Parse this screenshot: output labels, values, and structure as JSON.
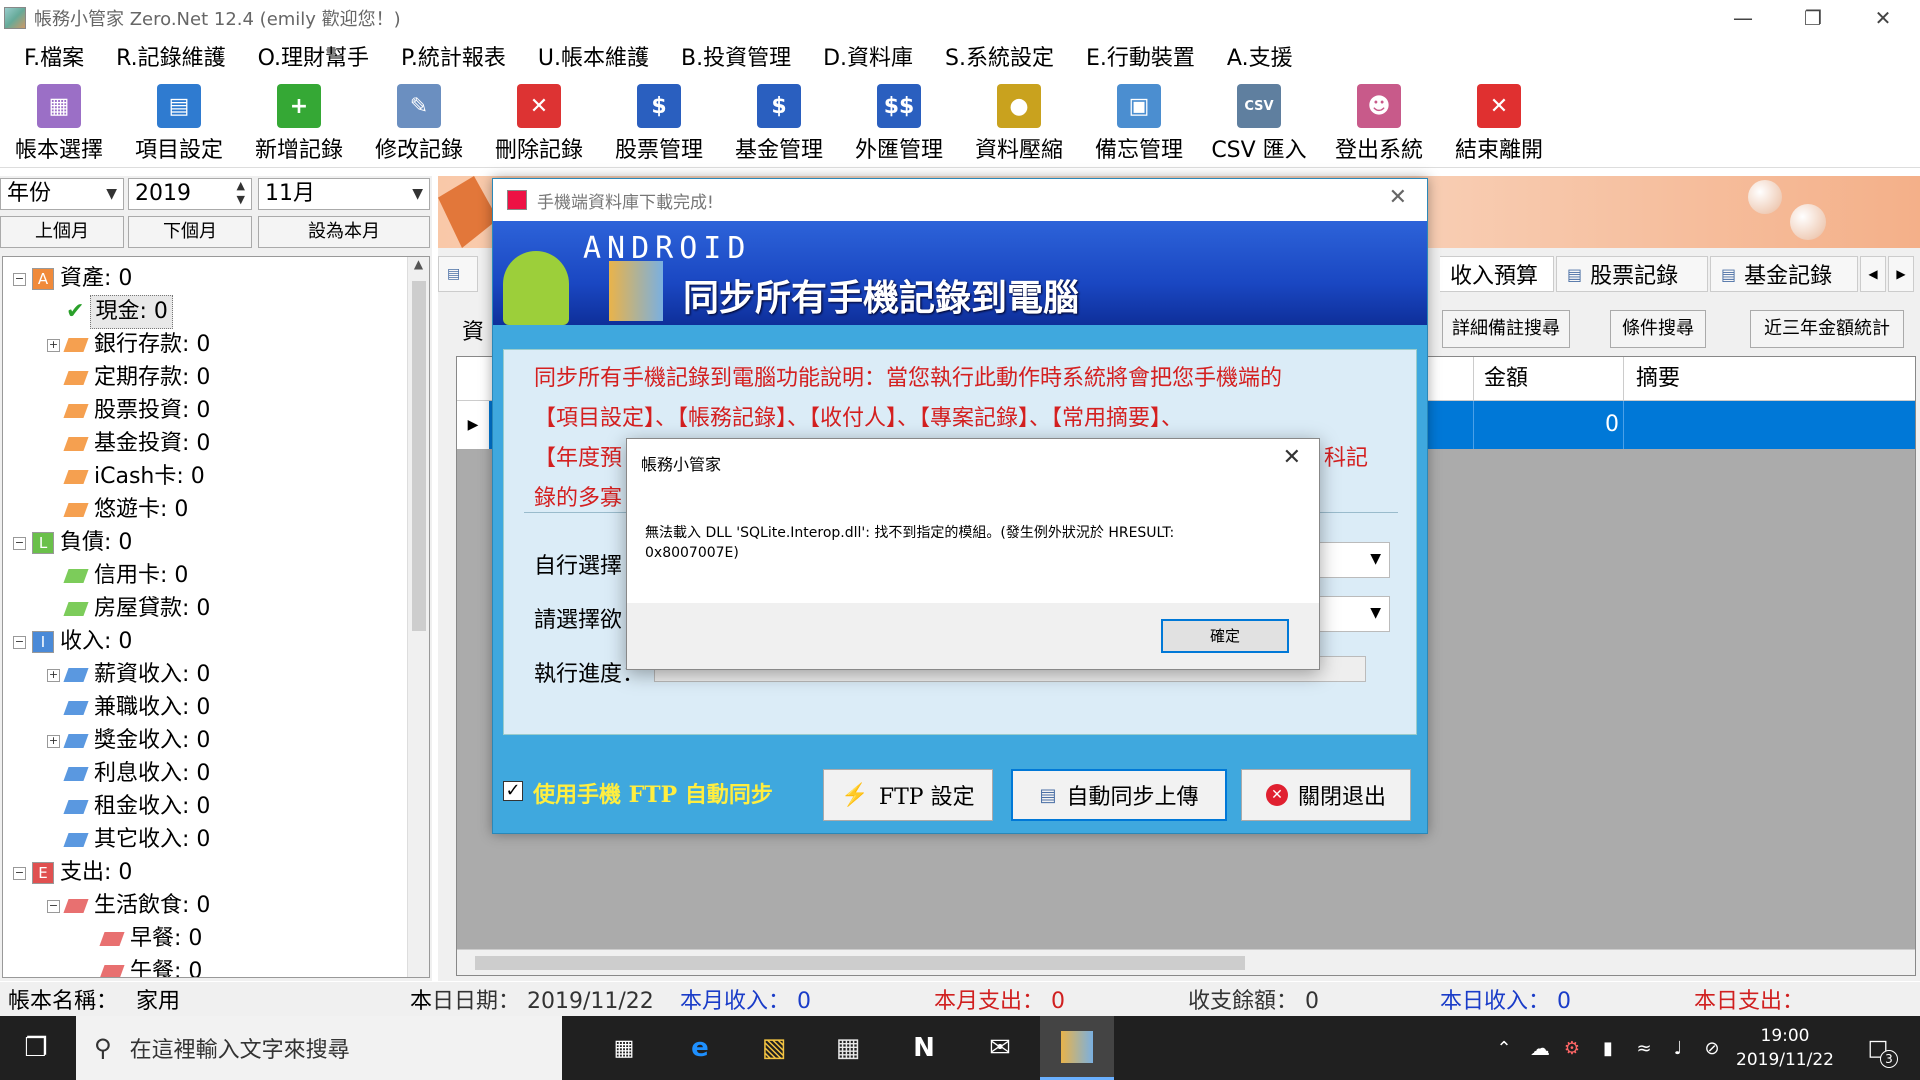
{
  "window": {
    "title": "帳務小管家 Zero.Net 12.4 (emily 歡迎您！)"
  },
  "menu": [
    "F.檔案",
    "R.記錄維護",
    "O.理財幫手",
    "P.統計報表",
    "U.帳本維護",
    "B.投資管理",
    "D.資料庫",
    "S.系統設定",
    "E.行動裝置",
    "A.支援"
  ],
  "toolbar": [
    {
      "label": "帳本選擇",
      "icon": "books-icon",
      "color": "#9b6fc6"
    },
    {
      "label": "項目設定",
      "icon": "table-icon",
      "color": "#2f7bd0"
    },
    {
      "label": "新增記錄",
      "icon": "add-icon",
      "color": "#35a835"
    },
    {
      "label": "修改記錄",
      "icon": "edit-icon",
      "color": "#6b8fc0"
    },
    {
      "label": "刪除記錄",
      "icon": "delete-icon",
      "color": "#d33"
    },
    {
      "label": "股票管理",
      "icon": "stock-icon",
      "color": "#2a5fbf"
    },
    {
      "label": "基金管理",
      "icon": "fund-icon",
      "color": "#2a5fbf"
    },
    {
      "label": "外匯管理",
      "icon": "forex-icon",
      "color": "#2a5fbf"
    },
    {
      "label": "資料壓縮",
      "icon": "compress-icon",
      "color": "#c9a21e"
    },
    {
      "label": "備忘管理",
      "icon": "monitor-icon",
      "color": "#4b8ed0"
    },
    {
      "label": "CSV 匯入",
      "icon": "csv-icon",
      "color": "#5f7f9f"
    },
    {
      "label": "登出系統",
      "icon": "users-icon",
      "color": "#c85a8a"
    },
    {
      "label": "結束離開",
      "icon": "exit-icon",
      "color": "#e03030"
    }
  ],
  "period": {
    "type": "年份",
    "year": "2019",
    "month": "11月"
  },
  "nav": {
    "prev": "上個月",
    "next": "下個月",
    "current": "設為本月"
  },
  "tree": [
    {
      "text": "資產: 0",
      "level": 0,
      "cat": "A",
      "catColor": "#f08a3a",
      "exp": "−"
    },
    {
      "text": "現金: 0",
      "level": 1,
      "selected": true,
      "check": true
    },
    {
      "text": "銀行存款: 0",
      "level": 1,
      "exp": "+",
      "gem": "#f5a050"
    },
    {
      "text": "定期存款: 0",
      "level": 1,
      "gem": "#f5a050"
    },
    {
      "text": "股票投資: 0",
      "level": 1,
      "gem": "#f5a050"
    },
    {
      "text": "基金投資: 0",
      "level": 1,
      "gem": "#f5a050"
    },
    {
      "text": "iCash卡: 0",
      "level": 1,
      "gem": "#f5a050"
    },
    {
      "text": "悠遊卡: 0",
      "level": 1,
      "gem": "#f5a050"
    },
    {
      "text": "負債: 0",
      "level": 0,
      "cat": "L",
      "catColor": "#6ac04a",
      "exp": "−"
    },
    {
      "text": "信用卡: 0",
      "level": 1,
      "gem": "#7ccc5a"
    },
    {
      "text": "房屋貸款: 0",
      "level": 1,
      "gem": "#7ccc5a"
    },
    {
      "text": "收入: 0",
      "level": 0,
      "cat": "I",
      "catColor": "#4a8ad8",
      "exp": "−"
    },
    {
      "text": "薪資收入: 0",
      "level": 1,
      "exp": "+",
      "gem": "#5a98e0"
    },
    {
      "text": "兼職收入: 0",
      "level": 1,
      "gem": "#5a98e0"
    },
    {
      "text": "獎金收入: 0",
      "level": 1,
      "exp": "+",
      "gem": "#5a98e0"
    },
    {
      "text": "利息收入: 0",
      "level": 1,
      "gem": "#5a98e0"
    },
    {
      "text": "租金收入: 0",
      "level": 1,
      "gem": "#5a98e0"
    },
    {
      "text": "其它收入: 0",
      "level": 1,
      "gem": "#5a98e0"
    },
    {
      "text": "支出: 0",
      "level": 0,
      "cat": "E",
      "catColor": "#e05050",
      "exp": "−"
    },
    {
      "text": "生活飲食: 0",
      "level": 1,
      "exp": "−",
      "gem": "#e87070"
    },
    {
      "text": "早餐: 0",
      "level": 2,
      "gem": "#e87070"
    },
    {
      "text": "午餐: 0",
      "level": 2,
      "gem": "#e87070"
    }
  ],
  "tabs": [
    "收入預算",
    "股票記錄",
    "基金記錄"
  ],
  "rightButtons": [
    "詳細備註搜尋",
    "條件搜尋",
    "近三年金額統計"
  ],
  "grid": {
    "columns": [
      "金額",
      "摘要"
    ],
    "row": {
      "amount": "0"
    },
    "partialLabel": "資"
  },
  "status": {
    "book_label": "帳本名稱：",
    "book": "家用",
    "date_prefix": "本",
    "date": "日日期：  2019/11/22",
    "month_income": "本月收入：  0",
    "month_expense": "本月支出：  0",
    "balance": "收支餘額：  0",
    "day_income": "本日收入：  0",
    "day_expense": "本日支出："
  },
  "sync": {
    "title": "手機端資料庫下載完成!",
    "android": "ANDROID",
    "heading": "同步所有手機記錄到電腦",
    "desc": [
      "同步所有手機記錄到電腦功能說明：當您執行此動作時系統將會把您手機端的",
      "【項目設定】、【帳務記錄】、【收付人】、【專案記錄】、【常用摘要】、",
      "【年度預",
      "錄的多寡"
    ],
    "desc_right": "科記",
    "label_choose": "自行選擇",
    "label_select": "請選擇欲",
    "label_progress": "執行進度：",
    "ftp_check": "使用手機 FTP 自動同步",
    "btn_ftp": "FTP 設定",
    "btn_sync": "自動同步上傳",
    "btn_close": "關閉退出"
  },
  "error": {
    "title": "帳務小管家",
    "message": "無法載入 DLL 'SQLite.Interop.dll': 找不到指定的模組。(發生例外狀況於 HRESULT:",
    "message2": "0x8007007E)",
    "ok": "確定"
  },
  "taskbar": {
    "search_placeholder": "在這裡輸入文字來搜尋",
    "time": "19:00",
    "date": "2019/11/22",
    "notif": "3"
  }
}
